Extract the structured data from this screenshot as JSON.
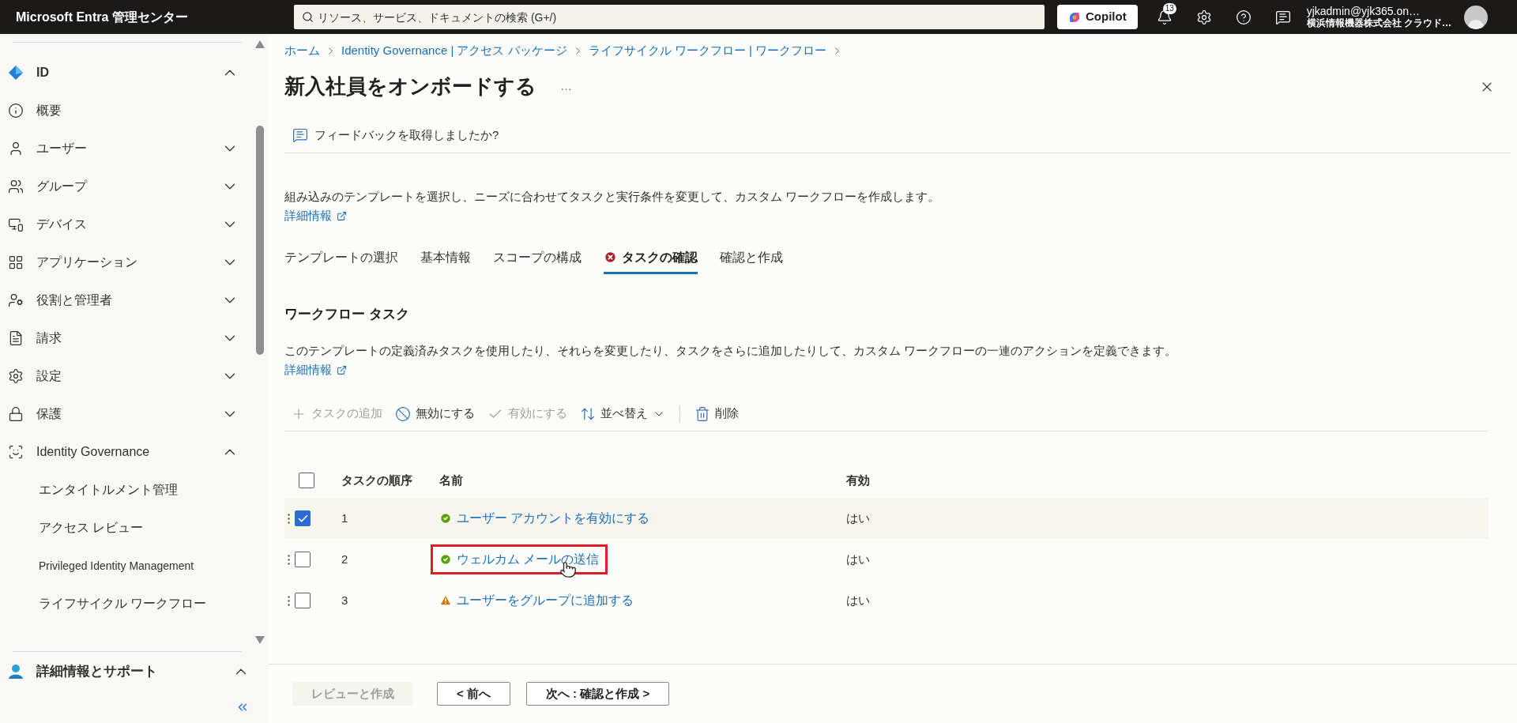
{
  "topbar": {
    "brand": "Microsoft Entra 管理センター",
    "search": {
      "placeholder": "リソース、サービス、ドキュメントの検索 (G+/)"
    },
    "copilot": "Copilot",
    "notifications": "13",
    "account": {
      "email": "yjkadmin@yjk365.on…",
      "org": "横浜情報機器株式会社 クラウド…"
    }
  },
  "sidebar": {
    "items": [
      {
        "label": "ID",
        "expanded": true,
        "bold": true
      },
      {
        "label": "概要"
      },
      {
        "label": "ユーザー",
        "expanded": false
      },
      {
        "label": "グループ",
        "expanded": false
      },
      {
        "label": "デバイス",
        "expanded": false
      },
      {
        "label": "アプリケーション",
        "expanded": false
      },
      {
        "label": "役割と管理者",
        "expanded": false
      },
      {
        "label": "請求",
        "expanded": false
      },
      {
        "label": "設定",
        "expanded": false
      },
      {
        "label": "保護",
        "expanded": false
      },
      {
        "label": "Identity Governance",
        "expanded": true,
        "children": [
          {
            "label": "エンタイトルメント管理"
          },
          {
            "label": "アクセス レビュー"
          },
          {
            "label": "Privileged Identity Management"
          },
          {
            "label": "ライフサイクル ワークフロー"
          }
        ]
      }
    ],
    "support": {
      "label": "詳細情報とサポート",
      "expanded": true
    }
  },
  "breadcrumb": [
    "ホーム",
    "Identity Governance | アクセス パッケージ",
    "ライフサイクル ワークフロー | ワークフロー"
  ],
  "page": {
    "title": "新入社員をオンボードする",
    "more": "…",
    "feedback": "フィードバックを取得しましたか?",
    "description": "組み込みのテンプレートを選択し、ニーズに合わせてタスクと実行条件を変更して、カスタム ワークフローを作成します。",
    "learn_more": "詳細情報"
  },
  "tabs": [
    {
      "label": "テンプレートの選択",
      "selected": false,
      "error": false
    },
    {
      "label": "基本情報",
      "selected": false,
      "error": false
    },
    {
      "label": "スコープの構成",
      "selected": false,
      "error": false
    },
    {
      "label": "タスクの確認",
      "selected": true,
      "error": true
    },
    {
      "label": "確認と作成",
      "selected": false,
      "error": false
    }
  ],
  "section": {
    "title": "ワークフロー タスク",
    "description": "このテンプレートの定義済みタスクを使用したり、それらを変更したり、タスクをさらに追加したりして、カスタム ワークフローの一連のアクションを定義できます。",
    "learn_more": "詳細情報"
  },
  "toolbar": [
    {
      "kind": "add",
      "label": "タスクの追加",
      "disabled": true
    },
    {
      "kind": "disable",
      "label": "無効にする",
      "disabled": false
    },
    {
      "kind": "enable",
      "label": "有効にする",
      "disabled": true
    },
    {
      "kind": "sort",
      "label": "並べ替え",
      "disabled": false
    },
    {
      "kind": "delete",
      "label": "削除",
      "disabled": false
    }
  ],
  "table": {
    "all_checked": false,
    "columns": [
      "タスクの順序",
      "名前",
      "有効"
    ],
    "rows": [
      {
        "order": "1",
        "name": "ユーザー アカウントを有効にする",
        "kind": "success",
        "enabled": "はい",
        "checked": true,
        "highlighted": false
      },
      {
        "order": "2",
        "name": "ウェルカム メールの送信",
        "kind": "success",
        "enabled": "はい",
        "checked": false,
        "highlighted": true
      },
      {
        "order": "3",
        "name": "ユーザーをグループに追加する",
        "kind": "warning",
        "enabled": "はい",
        "checked": false,
        "highlighted": false
      }
    ]
  },
  "footer": [
    {
      "label": "レビューと作成",
      "disabled": true
    },
    {
      "label": "< 前へ",
      "disabled": false
    },
    {
      "label": "次へ : 確認と作成 >",
      "disabled": false
    }
  ]
}
